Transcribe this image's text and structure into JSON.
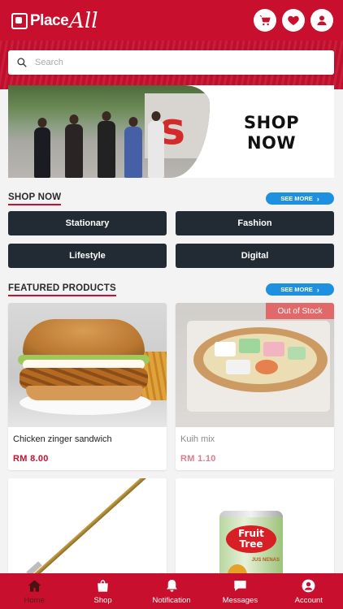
{
  "header": {
    "logo_word": "Place",
    "logo_script": "All",
    "icons": [
      "cart-icon",
      "heart-icon",
      "user-icon"
    ]
  },
  "search": {
    "placeholder": "Search"
  },
  "banner": {
    "headline_line1": "SHOP",
    "headline_line2": "NOW"
  },
  "shop_now": {
    "title": "SHOP NOW",
    "see_more": "SEE MORE",
    "categories": [
      "Stationary",
      "Fashion",
      "Lifestyle",
      "Digital"
    ]
  },
  "featured": {
    "title": "FEATURED PRODUCTS",
    "see_more": "SEE MORE",
    "products": [
      {
        "name": "Chicken zinger sandwich",
        "price": "RM 8.00",
        "badge": ""
      },
      {
        "name": "Kuih mix",
        "price": "RM 1.10",
        "badge": "Out of Stock"
      },
      {
        "name": "",
        "price": "",
        "badge": ""
      },
      {
        "name": "",
        "price": "",
        "badge": "",
        "can_brand_line1": "Fruit",
        "can_brand_line2": "Tree",
        "can_sub": "JUS NENAS"
      }
    ]
  },
  "bottom_nav": [
    {
      "label": "Home",
      "icon": "home-icon",
      "active": true
    },
    {
      "label": "Shop",
      "icon": "shopping-bag-icon",
      "active": false
    },
    {
      "label": "Notification",
      "icon": "bell-icon",
      "active": false
    },
    {
      "label": "Messages",
      "icon": "chat-icon",
      "active": false
    },
    {
      "label": "Account",
      "icon": "account-icon",
      "active": false
    }
  ],
  "colors": {
    "brand_red": "#c8102e",
    "dark_button": "#222a33",
    "see_more_blue": "#1f8fe0",
    "out_of_stock": "#e06a6a"
  }
}
